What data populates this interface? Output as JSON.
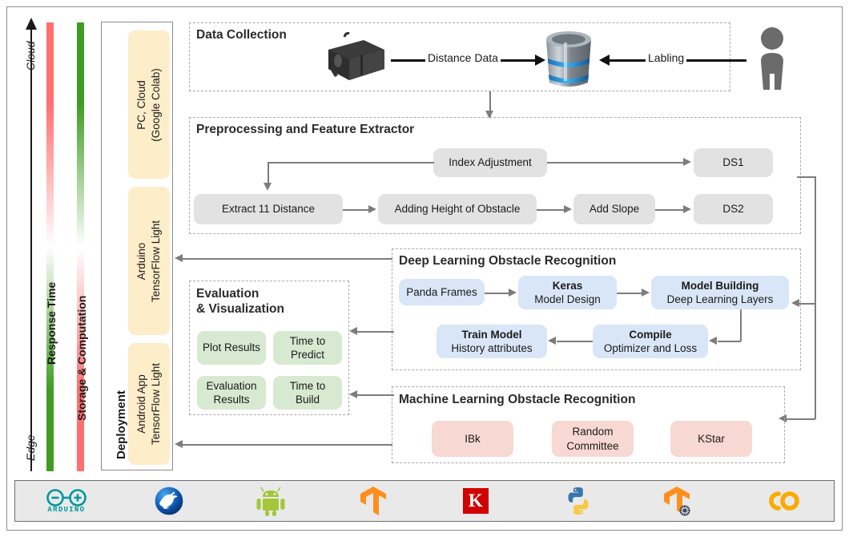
{
  "axis": {
    "top_label": "Cloud",
    "bottom_label": "Edge",
    "bars": [
      {
        "name": "response-time",
        "label": "Response Time",
        "top_color": "#ff6f6f",
        "bottom_color": "#3f9c23"
      },
      {
        "name": "storage-computation",
        "label": "Storage & Computation",
        "top_color": "#3f9c23",
        "bottom_color": "#ff6f6f"
      }
    ]
  },
  "deployment": {
    "title": "Deployment",
    "boxes": [
      {
        "label": "PC, Cloud\n(Google Colab)"
      },
      {
        "label": "Arduino\nTensorFlow Light"
      },
      {
        "label": "Android App\nTensorFlow Light"
      }
    ]
  },
  "data_collection": {
    "title": "Data Collection",
    "sensor_icon": "lidar-sensor-icon",
    "database_icon": "database-icon",
    "person_icon": "person-icon",
    "edge_sensor_to_db": "Distance Data",
    "edge_person_to_db": "Labling"
  },
  "preprocessing": {
    "title": "Preprocessing and Feature Extractor",
    "nodes": [
      {
        "label": "Index Adjustment"
      },
      {
        "label": "DS1"
      },
      {
        "label": "Extract 11 Distance"
      },
      {
        "label": "Adding Height of Obstacle"
      },
      {
        "label": "Add Slope"
      },
      {
        "label": "DS2"
      }
    ]
  },
  "deep_learning": {
    "title": "Deep Learning Obstacle Recognition",
    "nodes": [
      {
        "head": "",
        "sub": "Panda Frames"
      },
      {
        "head": "Keras",
        "sub": "Model Design"
      },
      {
        "head": "Model Building",
        "sub": "Deep Learning Layers"
      },
      {
        "head": "Compile",
        "sub": "Optimizer and Loss"
      },
      {
        "head": "Train Model",
        "sub": "History attributes"
      }
    ]
  },
  "machine_learning": {
    "title": "Machine Learning Obstacle Recognition",
    "nodes": [
      {
        "label": "IBk"
      },
      {
        "label": "Random\nCommittee"
      },
      {
        "label": "KStar"
      }
    ]
  },
  "evaluation": {
    "title": "Evaluation\n& Visualization",
    "nodes": [
      {
        "label": "Plot Results"
      },
      {
        "label": "Time to\nPredict"
      },
      {
        "label": "Evaluation\nResults"
      },
      {
        "label": "Time to\nBuild"
      }
    ]
  },
  "logo_bar": {
    "items": [
      {
        "name": "arduino-logo",
        "label": "ARDUINO",
        "color": "#00979c"
      },
      {
        "name": "weka-logo",
        "label": "",
        "color": "#1a5fb4"
      },
      {
        "name": "android-logo",
        "label": "",
        "color": "#a4c639"
      },
      {
        "name": "tensorflow-logo",
        "label": "",
        "color": "#ff8f1c"
      },
      {
        "name": "keras-logo",
        "label": "K",
        "color": "#d00000"
      },
      {
        "name": "python-logo",
        "label": "",
        "color": "#3776ab"
      },
      {
        "name": "tensorflow-lite-logo",
        "label": "",
        "color": "#ff8f1c"
      },
      {
        "name": "google-colab-logo",
        "label": "",
        "color": "#f9ab00"
      }
    ]
  }
}
